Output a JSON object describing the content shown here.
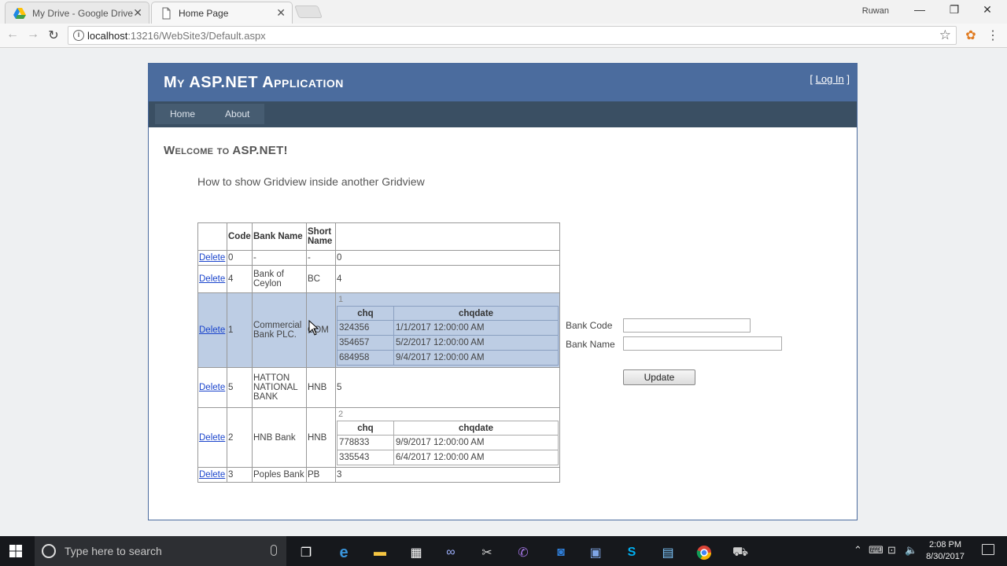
{
  "browser": {
    "tabs": [
      {
        "label": "My Drive - Google Drive",
        "icon": "google-drive-icon"
      },
      {
        "label": "Home Page",
        "icon": "page-icon"
      }
    ],
    "profile_name": "Ruwan",
    "url_host": "localhost",
    "url_path": ":13216/WebSite3/Default.aspx"
  },
  "site": {
    "title": "My ASP.NET Application",
    "login_prefix": "[ ",
    "login_label": "Log In",
    "login_suffix": " ]",
    "menu": [
      "Home",
      "About"
    ],
    "welcome": "Welcome to ASP.NET!",
    "subtitle": "How to show Gridview inside another Gridview"
  },
  "grid": {
    "headers": [
      "",
      "Code",
      "Bank Name",
      "Short Name",
      ""
    ],
    "delete_label": "Delete",
    "rows": [
      {
        "code": "0",
        "name": "-",
        "short": "-",
        "id": "0"
      },
      {
        "code": "4",
        "name": "Bank of Ceylon",
        "short": "BC",
        "id": "4"
      },
      {
        "code": "1",
        "name": "Commercial Bank PLC.",
        "short": "COM",
        "id": "1",
        "cheques": {
          "headers": [
            "chq",
            "chqdate"
          ],
          "rows": [
            [
              "324356",
              "1/1/2017 12:00:00 AM"
            ],
            [
              "354657",
              "5/2/2017 12:00:00 AM"
            ],
            [
              "684958",
              "9/4/2017 12:00:00 AM"
            ]
          ]
        }
      },
      {
        "code": "5",
        "name": "HATTON NATIONAL BANK",
        "short": "HNB",
        "id": "5"
      },
      {
        "code": "2",
        "name": "HNB Bank",
        "short": "HNB",
        "id": "2",
        "cheques": {
          "headers": [
            "chq",
            "chqdate"
          ],
          "rows": [
            [
              "778833",
              "9/9/2017 12:00:00 AM"
            ],
            [
              "335543",
              "6/4/2017 12:00:00 AM"
            ]
          ]
        }
      },
      {
        "code": "3",
        "name": "Poples Bank",
        "short": "PB",
        "id": "3"
      }
    ],
    "selected_row_index": 2
  },
  "form": {
    "bank_code_label": "Bank Code",
    "bank_code_value": "",
    "bank_name_label": "Bank Name",
    "bank_name_value": "",
    "update_label": "Update"
  },
  "taskbar": {
    "search_placeholder": "Type here to search",
    "time": "2:08 PM",
    "date": "8/30/2017"
  },
  "colors": {
    "header_blue": "#4b6c9e",
    "menu_dark": "#3a4f63",
    "selected_row": "#bdcde4"
  }
}
